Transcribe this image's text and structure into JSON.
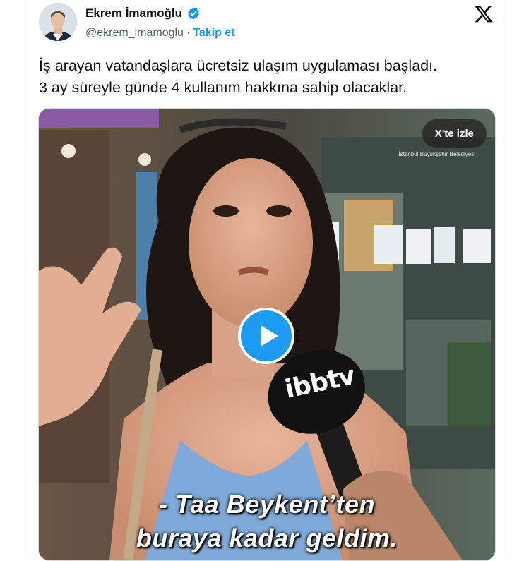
{
  "author": {
    "name": "Ekrem İmamoğlu",
    "handle": "@ekrem_imamoglu",
    "separator": "·",
    "follow_label": "Takip et"
  },
  "tweet": {
    "line1": "İş arayan vatandaşlara ücretsiz ulaşım uygulaması başladı.",
    "line2": "3 ay süreyle günde 4 kullanım hakkına sahip olacaklar."
  },
  "media": {
    "watch_label": "X'te izle",
    "corner_logo": "İstanbul Büyükşehir Belediyesi",
    "mic_brand": "ibbtv",
    "subtitle_line1": "- Taa Beykent’ten",
    "subtitle_line2": "buraya kadar geldim."
  },
  "colors": {
    "accent": "#1d9bf0",
    "verified": "#1d9bf0"
  },
  "icons": [
    "verified-badge-icon",
    "x-logo-icon",
    "play-icon"
  ]
}
